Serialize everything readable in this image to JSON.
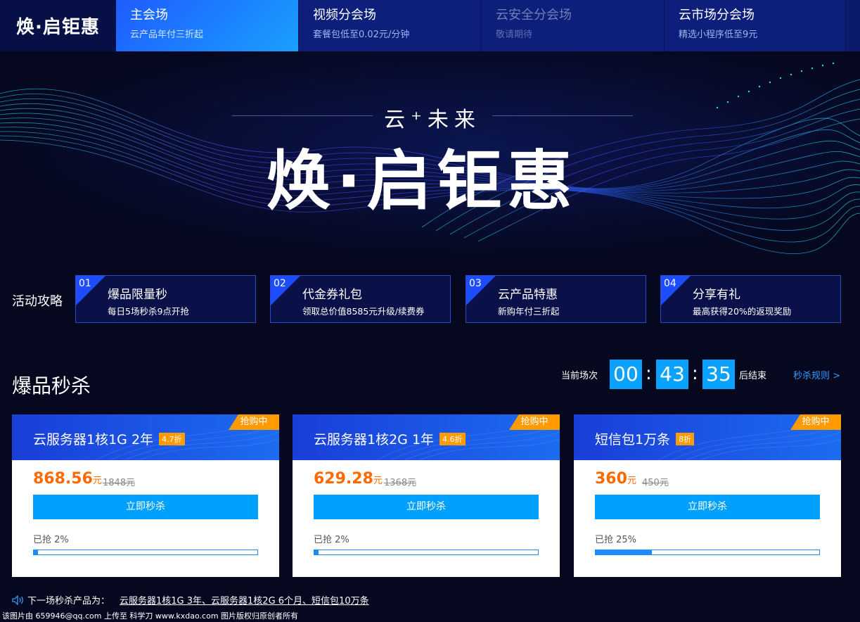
{
  "header": {
    "logo": "焕·启钜惠",
    "tabs": [
      {
        "title": "主会场",
        "desc": "云产品年付三折起"
      },
      {
        "title": "视频分会场",
        "desc": "套餐包低至0.02元/分钟"
      },
      {
        "title": "云安全分会场",
        "desc": "敬请期待"
      },
      {
        "title": "云市场分会场",
        "desc": "精选小程序低至9元"
      }
    ]
  },
  "hero": {
    "subtitle": "云⁺未来",
    "title": "焕·启钜惠"
  },
  "guide": {
    "label": "活动攻略",
    "items": [
      {
        "num": "01",
        "title": "爆品限量秒",
        "desc": "每日5场秒杀9点开抢"
      },
      {
        "num": "02",
        "title": "代金券礼包",
        "desc": "领取总价值8585元升级/续费券"
      },
      {
        "num": "03",
        "title": "云产品特惠",
        "desc": "新购年付三折起"
      },
      {
        "num": "04",
        "title": "分享有礼",
        "desc": "最高获得20%的返现奖励"
      }
    ]
  },
  "flash": {
    "title": "爆品秒杀",
    "round_label": "当前场次",
    "countdown": {
      "h": "00",
      "m": "43",
      "s": "35"
    },
    "end_label": "后结束",
    "rules": "秒杀规则 >",
    "products": [
      {
        "badge": "抢购中",
        "name": "云服务器1核1G 2年",
        "discount": "4.7折",
        "price": "868.56",
        "unit": "元",
        "original": "1848元",
        "button": "立即秒杀",
        "sold": "已抢 2%",
        "progress": 0.02
      },
      {
        "badge": "抢购中",
        "name": "云服务器1核2G 1年",
        "discount": "4.6折",
        "price": "629.28",
        "unit": "元",
        "original": "1368元",
        "button": "立即秒杀",
        "sold": "已抢 2%",
        "progress": 0.02
      },
      {
        "badge": "抢购中",
        "name": "短信包1万条",
        "discount": "8折",
        "price": "360",
        "unit": "元",
        "original": "450元",
        "button": "立即秒杀",
        "sold": "已抢 25%",
        "progress": 0.25
      }
    ],
    "next_label": "下一场秒杀产品为：",
    "next_items": "云服务器1核1G 3年、云服务器1核2G 6个月、短信包10万条"
  },
  "footer": "该图片由 659946@qq.com 上传至 科学刀 www.kxdao.com 图片版权归原创者所有",
  "colors": {
    "accent": "#00a0ff",
    "price": "#ff6a00",
    "badge": "#ff9a00",
    "nav": "#0d1f7a"
  }
}
